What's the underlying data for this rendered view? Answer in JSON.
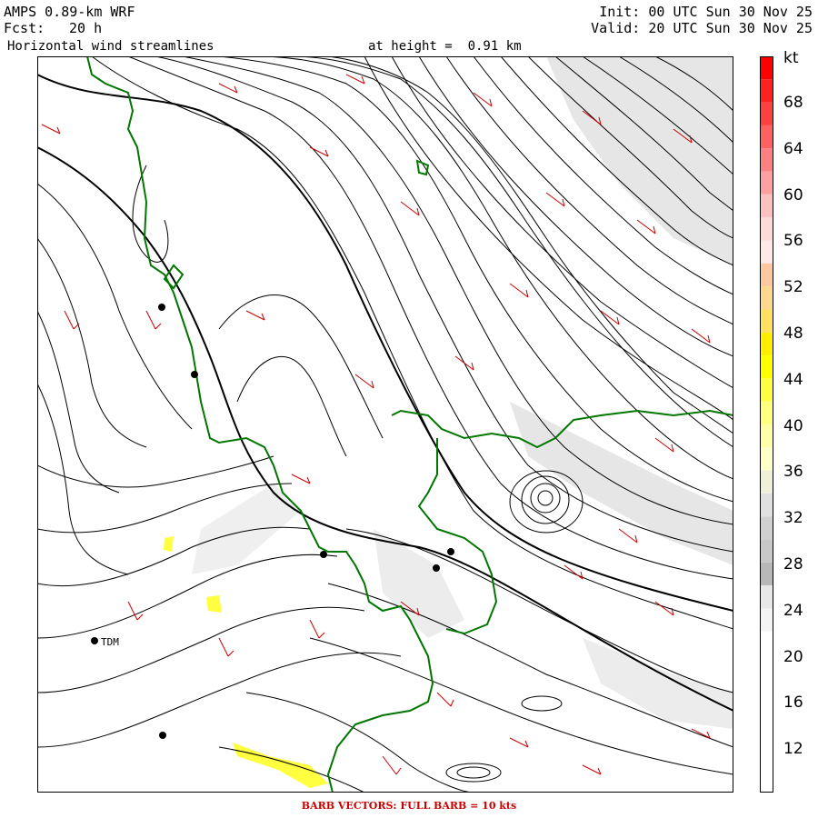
{
  "header": {
    "model": "AMPS 0.89-km WRF",
    "forecast_label": "Fcst:",
    "forecast_hours": "20 h",
    "product": "Horizontal wind streamlines",
    "height_label": "at height =  0.91 km",
    "init": "Init: 00 UTC Sun 30 Nov 25",
    "valid": "Valid: 20 UTC Sun 30 Nov 25"
  },
  "colorbar": {
    "unit": "kt",
    "labels": [
      "68",
      "64",
      "60",
      "56",
      "52",
      "48",
      "44",
      "40",
      "36",
      "32",
      "28",
      "24",
      "20",
      "16",
      "12"
    ],
    "colors": [
      "#ff0000",
      "#ff2020",
      "#ff4040",
      "#ff6060",
      "#ff8080",
      "#ffa0a0",
      "#ffc0c0",
      "#ffd8d8",
      "#ffe8e8",
      "#ffc8a0",
      "#ffd890",
      "#ffe060",
      "#ffee00",
      "#ffff00",
      "#ffff40",
      "#ffff80",
      "#ffffa8",
      "#ffffc8",
      "#f0f0d8",
      "#e0e0e0",
      "#d0d0d0",
      "#c8c8c8",
      "#b8b8b8",
      "#e8e8e8",
      "#f4f4f4",
      "#ffffff",
      "#ffffff",
      "#ffffff",
      "#ffffff",
      "#ffffff",
      "#ffffff",
      "#ffffff"
    ]
  },
  "stations": [
    {
      "label": "TDM"
    }
  ],
  "caption": "BARB VECTORS:  FULL BARB = 10 kts"
}
